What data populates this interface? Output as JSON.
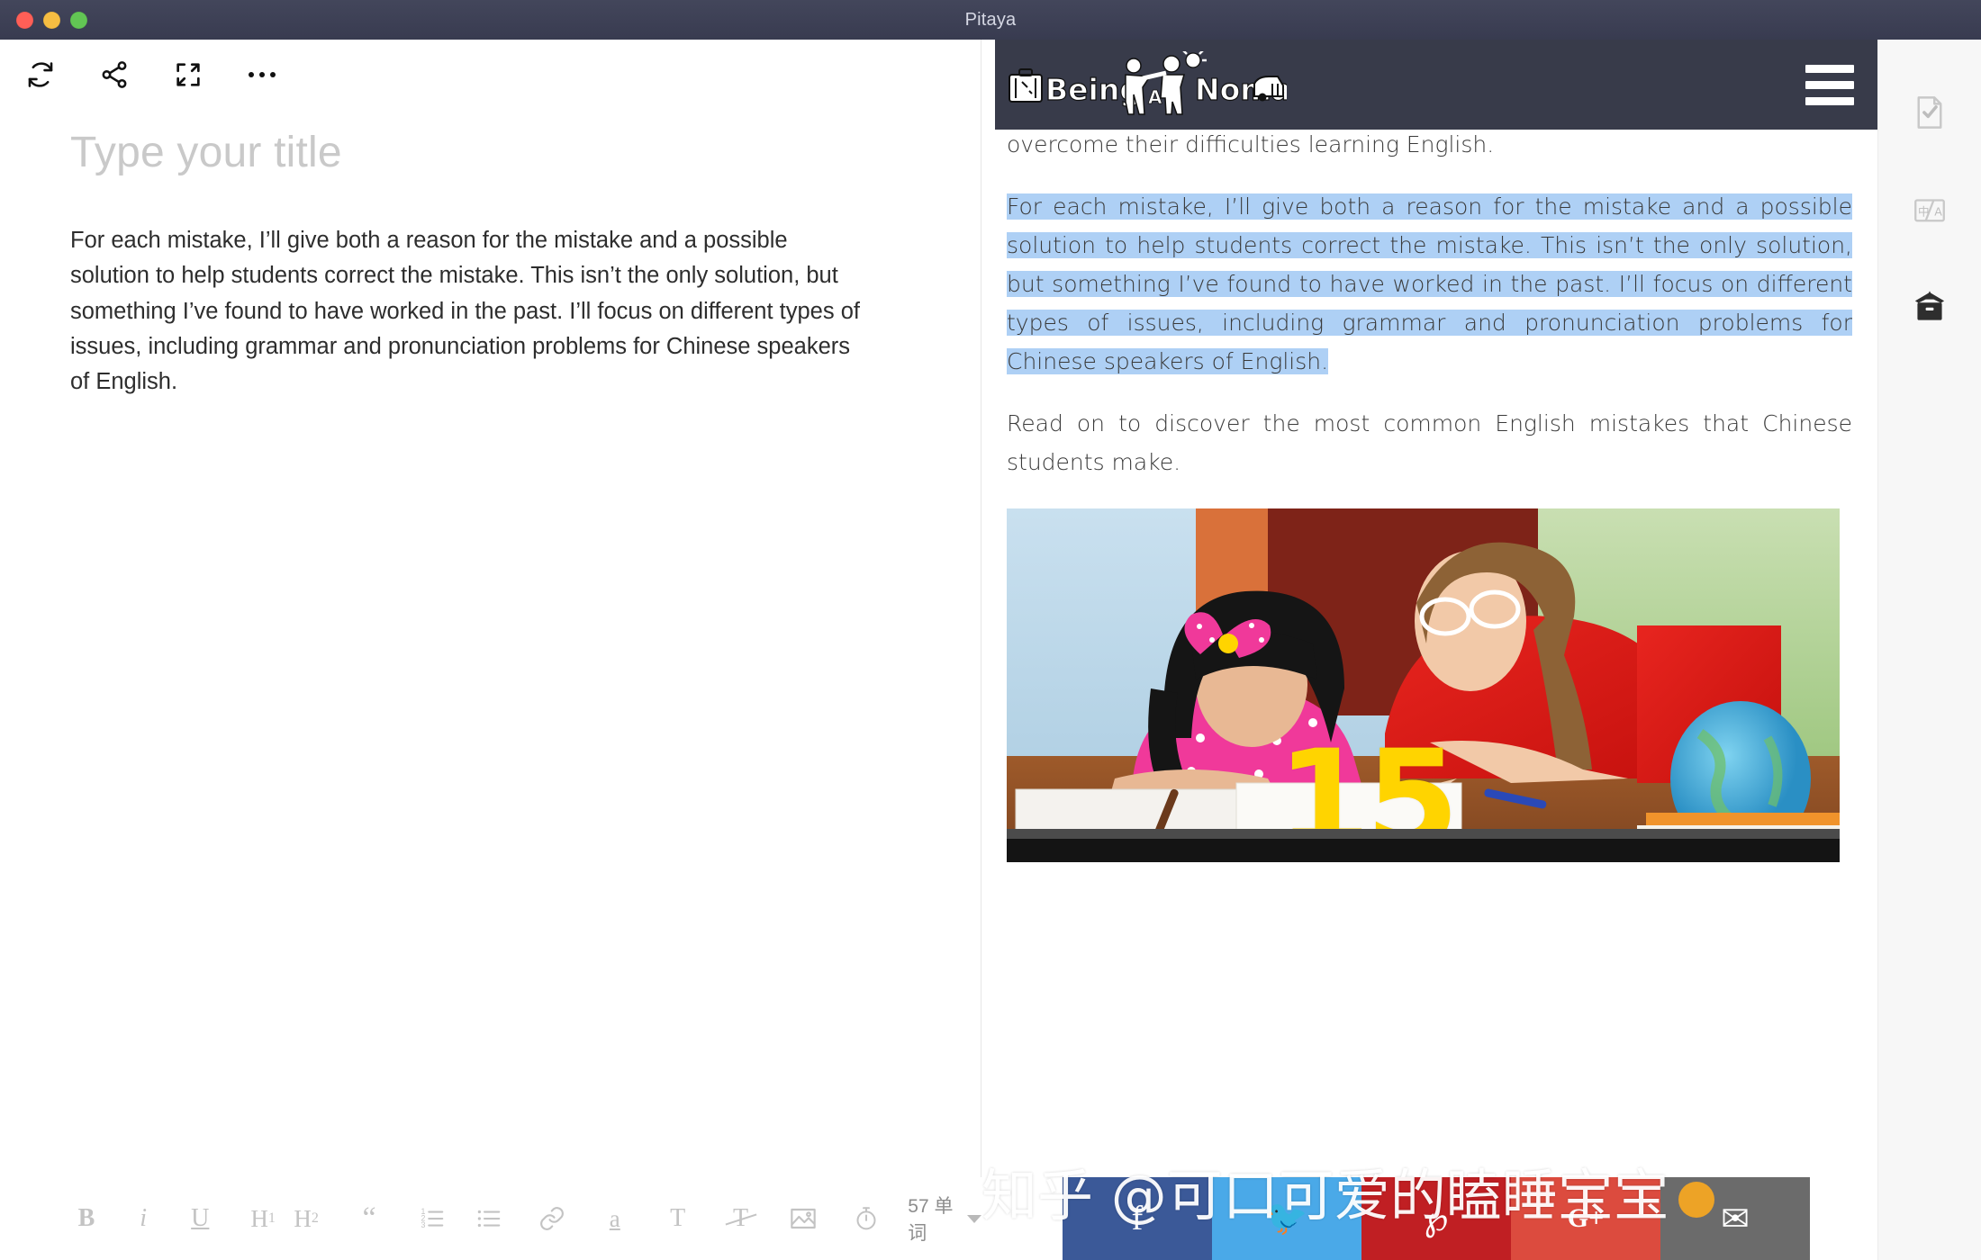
{
  "window": {
    "title": "Pitaya",
    "traffic_lights": [
      "close",
      "minimize",
      "zoom"
    ]
  },
  "editor": {
    "toolbar": [
      {
        "name": "sync-icon",
        "label": "Sync"
      },
      {
        "name": "share-icon",
        "label": "Share"
      },
      {
        "name": "fullscreen-icon",
        "label": "Fullscreen"
      },
      {
        "name": "more-icon",
        "label": "More"
      }
    ],
    "title_placeholder": "Type your title",
    "body": "For each mistake, I’ll give both a reason for the mistake and a possible solution to help students correct the mistake. This isn’t the only solution, but something I’ve found to have worked in the past. I’ll focus on different types of issues, including grammar and pronunciation problems for Chinese speakers of English.",
    "format_bar": {
      "bold": "B",
      "italic": "i",
      "underline": "U",
      "h1": "H",
      "h1_sub": "1",
      "h2": "H",
      "h2_sub": "2",
      "quote": "“",
      "ordered_list": "ordered-list-icon",
      "unordered_list": "unordered-list-icon",
      "link": "link-icon",
      "highlight": "a",
      "text_style": "T",
      "clear_format": "T",
      "image": "image-icon",
      "timer": "timer-icon",
      "word_count": "57 单词"
    }
  },
  "preview": {
    "site_header": {
      "logo_text_1": "Being",
      "logo_text_a": "A",
      "logo_text_2": "Nomad",
      "menu": "hamburger-menu-icon"
    },
    "paragraphs": [
      {
        "id": "p-above",
        "text": "to Chinese students. But students can use it as well to help them overcome their difficulties learning English.",
        "selected": false
      },
      {
        "id": "p-selected",
        "text": "For each mistake, I’ll give both a reason for the mistake and a possible solution to help students correct the mistake. This isn’t the only solution, but something I’ve found to have worked in the past. I’ll focus on different types of issues, including grammar and pronunciation problems for Chinese speakers of English.",
        "selected": true
      },
      {
        "id": "p-below",
        "text": "Read on to discover the most common English mistakes that Chinese students make.",
        "selected": false
      }
    ],
    "photo": {
      "alt": "teacher-helping-student-photo",
      "overlay_number": "15"
    },
    "social_buttons": [
      {
        "name": "facebook-share-button",
        "glyph": "f",
        "color": "#3b5998"
      },
      {
        "name": "twitter-share-button",
        "glyph": "🐦",
        "color": "#4aa9e8"
      },
      {
        "name": "pinterest-share-button",
        "glyph": "℘",
        "color": "#c01f23"
      },
      {
        "name": "googleplus-share-button",
        "glyph": "G+",
        "color": "#dc4b3e"
      },
      {
        "name": "email-share-button",
        "glyph": "✉",
        "color": "#6b6b6b"
      }
    ],
    "watermark": "知乎 @可口可爱的瞌睡宝宝"
  },
  "rail": {
    "items": [
      {
        "name": "document-check-icon",
        "label": "Proofread",
        "active": false
      },
      {
        "name": "translate-icon",
        "label": "Translate",
        "active": false
      },
      {
        "name": "publish-box-icon",
        "label": "Publish",
        "active": true
      }
    ]
  },
  "colors": {
    "titlebar": "#3d4055",
    "selection": "#aed0f5",
    "site_header": "#383b4a",
    "accent_yellow": "#ffd400"
  }
}
